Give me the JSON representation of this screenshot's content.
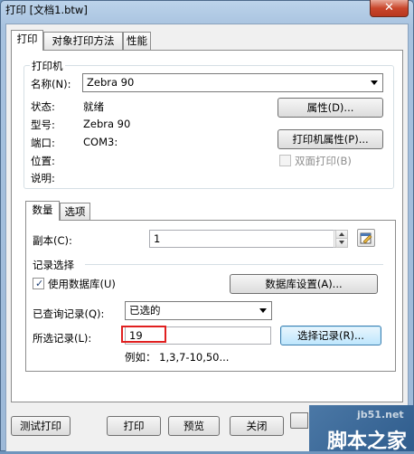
{
  "window": {
    "title": "打印 [文档1.btw]",
    "close_glyph": "✕"
  },
  "tabs": [
    {
      "label": "打印",
      "active": true
    },
    {
      "label": "对象打印方法",
      "active": false
    },
    {
      "label": "性能",
      "active": false
    }
  ],
  "printer_group": {
    "title": "打印机",
    "name_label": "名称(N):",
    "name_value": "Zebra 90",
    "status_label": "状态:",
    "status_value": "就绪",
    "model_label": "型号:",
    "model_value": "Zebra 90",
    "port_label": "端口:",
    "port_value": "COM3:",
    "location_label": "位置:",
    "comment_label": "说明:",
    "properties_button": "属性(D)...",
    "printer_properties_button": "打印机属性(P)...",
    "duplex_label": "双面打印(B)"
  },
  "inner_tabs": [
    {
      "label": "数量",
      "active": true
    },
    {
      "label": "选项",
      "active": false
    }
  ],
  "quantity": {
    "copies_label": "副本(C):",
    "copies_value": "1",
    "record_selection_title": "记录选择",
    "use_database_label": "使用数据库(U)",
    "use_database_checked": true,
    "database_settings_button": "数据库设置(A)...",
    "queried_records_label": "已查询记录(Q):",
    "queried_records_value": "已选的",
    "selected_records_label": "所选记录(L):",
    "selected_records_value": "19",
    "select_records_button": "选择记录(R)...",
    "example_text": "例如：  1,3,7-10,50..."
  },
  "footer": {
    "test_print_button": "测试打印",
    "print_button": "打印",
    "preview_button": "预览",
    "close_button": "关闭"
  },
  "watermark": {
    "site": "jb51.net",
    "brand": "脚本之家"
  },
  "colors": {
    "highlight": "#e02020",
    "title_bar": "#a7c2df",
    "close_button": "#c9462c"
  }
}
